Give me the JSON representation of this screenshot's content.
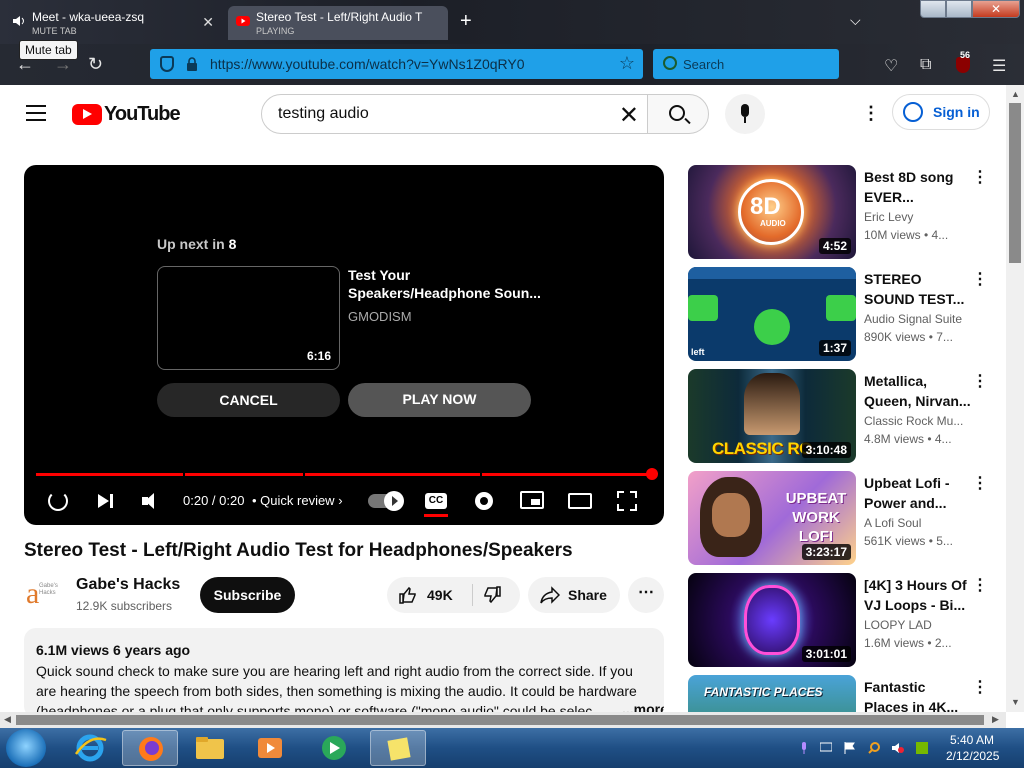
{
  "browser": {
    "tabs": [
      {
        "title": "Meet - wka-ueea-zsq",
        "subtitle": "MUTE TAB"
      },
      {
        "title": "Stereo Test - Left/Right Audio T",
        "subtitle": "PLAYING"
      }
    ],
    "tooltip": "Mute tab",
    "url": "https://www.youtube.com/watch?v=YwNs1Z0qRY0",
    "search_placeholder": "Search",
    "extension_badge": "56"
  },
  "youtube": {
    "logo_text": "YouTube",
    "search_value": "testing audio",
    "signin_label": "Sign in"
  },
  "player": {
    "upnext_label": "Up next in",
    "upnext_seconds": "8",
    "upnext_title": "Test Your Speakers/Headphone Soun...",
    "upnext_channel": "GMODISM",
    "upnext_duration": "6:16",
    "cancel_label": "CANCEL",
    "play_now_label": "PLAY NOW",
    "time": "0:20 / 0:20",
    "chapter": "• Quick review",
    "cc_label": "CC",
    "progress_fraction": 1.0
  },
  "video": {
    "title": "Stereo Test - Left/Right Audio Test for Headphones/Speakers",
    "channel_name": "Gabe's Hacks",
    "channel_avatar_text": "Gabe's Hacks",
    "subscribers": "12.9K subscribers",
    "subscribe_label": "Subscribe",
    "likes": "49K",
    "share_label": "Share",
    "views_date": "6.1M views  6 years ago",
    "description": "Quick sound check to make sure you are hearing left and right audio from the correct side. If you are hearing the speech from both sides, then something is mixing the audio. It could be hardware (headphones or a plug that only supports mono) or software (\"mono audio\" could be selec...",
    "more_label": "...more"
  },
  "recommendations": [
    {
      "title": "Best 8D song EVER...",
      "channel": "Eric Levy",
      "meta": "10M views  •  4...",
      "duration": "4:52",
      "thumb_text": "8D",
      "thumb_sub": "AUDIO"
    },
    {
      "title": "STEREO SOUND TEST...",
      "channel": "Audio Signal Suite",
      "meta": "890K views  •  7...",
      "duration": "1:37",
      "thumb_text": "left"
    },
    {
      "title": "Metallica, Queen, Nirvan...",
      "channel": "Classic Rock Mu...",
      "meta": "4.8M views  •  4...",
      "duration": "3:10:48",
      "thumb_text": "CLASSIC RO"
    },
    {
      "title": "Upbeat Lofi - Power and...",
      "channel": "A Lofi Soul",
      "meta": "561K views  •  5...",
      "duration": "3:23:17",
      "thumb_text": "UPBEAT WORK LOFI"
    },
    {
      "title": "[4K] 3 Hours Of VJ Loops - Bi...",
      "channel": "LOOPY LAD",
      "meta": "1.6M views  •  2...",
      "duration": "3:01:01"
    },
    {
      "title": "Fantastic Places in 4K...",
      "thumb_text": "FANTASTIC PLACES"
    }
  ],
  "taskbar": {
    "time": "5:40 AM",
    "date": "2/12/2025"
  },
  "colors": {
    "youtube_red": "#ff0000",
    "browser_urlbar": "#1fa0e8",
    "link_blue": "#065fd4",
    "taskbar": "#1f4f85"
  },
  "icons": [
    "speaker-icon",
    "youtube-favicon",
    "close-icon",
    "plus-icon",
    "chevron-down-icon",
    "back-icon",
    "forward-icon",
    "reload-icon",
    "shield-icon",
    "lock-icon",
    "star-icon",
    "search-icon",
    "pocket-icon",
    "extensions-icon",
    "ublock-icon",
    "hamburger-icon",
    "mic-icon",
    "more-vert-icon",
    "user-circle-icon",
    "replay-icon",
    "next-icon",
    "volume-icon",
    "settings-icon",
    "miniplayer-icon",
    "theater-icon",
    "fullscreen-icon",
    "thumbs-up-icon",
    "thumbs-down-icon",
    "share-icon"
  ]
}
